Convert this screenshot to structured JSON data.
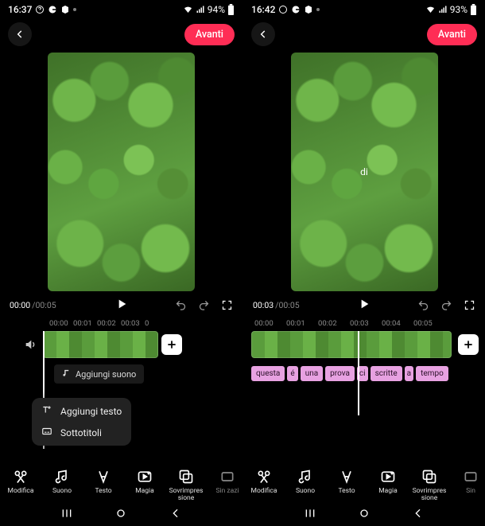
{
  "left": {
    "status": {
      "time": "16:37",
      "battery": "94%"
    },
    "header": {
      "next": "Avanti"
    },
    "transport": {
      "current": "00:00",
      "duration": "/00:05"
    },
    "ruler": [
      "00:00",
      "00:01",
      "00:02",
      "00:03",
      "0"
    ],
    "add_sound": "Aggiungi suono",
    "popup": {
      "add_text": "Aggiungi testo",
      "subtitles": "Sottotitoli"
    },
    "toolbar": [
      "Modifica",
      "Suono",
      "Testo",
      "Magia",
      "Sovrimpres sione",
      "Sin zazi"
    ]
  },
  "right": {
    "status": {
      "time": "16:42",
      "battery": "93%"
    },
    "header": {
      "next": "Avanti"
    },
    "preview_caption": "di",
    "transport": {
      "current": "00:03",
      "duration": "/00:05"
    },
    "ruler": [
      "00:00",
      "00:01",
      "00:02",
      "00:03",
      "00:04",
      "00:05"
    ],
    "subtitles": [
      "questa",
      "é",
      "una",
      "prova",
      "ci",
      "scritte",
      "a",
      "tempo"
    ],
    "toolbar": [
      "Modifica",
      "Suono",
      "Testo",
      "Magia",
      "Sovrimpres sione",
      "Sin"
    ]
  }
}
